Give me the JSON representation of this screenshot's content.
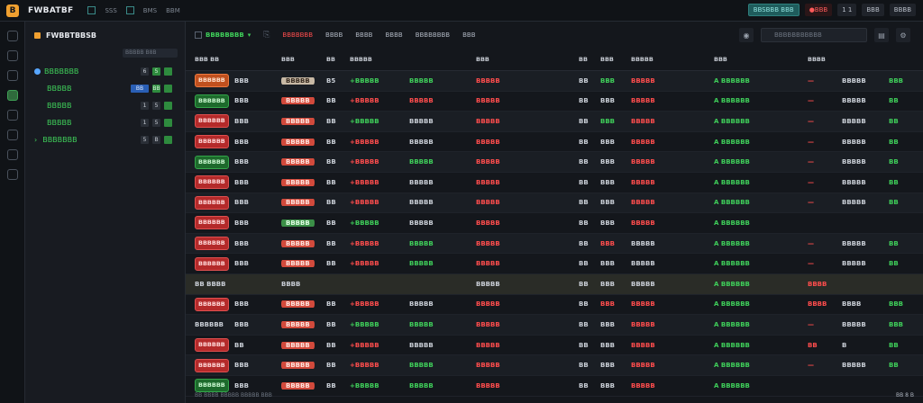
{
  "app": {
    "logo": "B",
    "title": "FWBATBF"
  },
  "top_menu": [
    "SSS",
    "BMS",
    "BBM"
  ],
  "top_right": {
    "account": "BBSBBB",
    "tag": "BBB",
    "alert": "BBB",
    "nums": "1 1",
    "stat": "BBB",
    "badge": "BBBB"
  },
  "icon_names": [
    "home-icon",
    "refresh-icon",
    "chart-icon",
    "layers-icon",
    "globe-icon",
    "bell-icon",
    "file-icon",
    "settings-icon"
  ],
  "left_panel": {
    "title": "FWBBTBBSB",
    "search_placeholder": "BBBBB B8B",
    "items": [
      {
        "label": "BBBBBBB",
        "num": "6",
        "ctrl": "5"
      },
      {
        "label": "BBBBB",
        "num": "BB",
        "ctrl": "BB"
      },
      {
        "label": "BBBBB",
        "num": "1",
        "ctrl": "5"
      },
      {
        "label": "BBBBB",
        "num": "1",
        "ctrl": "5"
      },
      {
        "label": "BBBBBBB",
        "num": "5",
        "ctrl": "B"
      }
    ]
  },
  "tabs": {
    "dropdown": "BBBBBBBB",
    "items": [
      "BBBBBBB",
      "BBBB",
      "BBBB",
      "BBBB",
      "BBBBBBBB",
      "BBB"
    ],
    "active_index": 0,
    "search_placeholder": "BBBBBBBBBBB"
  },
  "table": {
    "headers": [
      "BBB BB",
      "",
      "BBB",
      "BB",
      "BBBBB",
      "",
      "BBB",
      "BB",
      "BBB",
      "BBBBB",
      "BBB",
      "BBBB",
      "",
      ""
    ],
    "rows": [
      {
        "c0": "BBBBBB",
        "c0s": "orange",
        "c1": "BBB",
        "c2": "BBBBB",
        "c2s": "w",
        "c3": "B5",
        "c4": "+BBBBB",
        "c4d": "up",
        "c5": "BBBBB",
        "c5d": "up",
        "c6": "BBBBB",
        "c6d": "dn",
        "c7": "BB",
        "c8": "BBB",
        "c8d": "up",
        "c9": "BBBBB",
        "c9d": "dn",
        "c10": "A BBBBBB",
        "c10d": "up",
        "c11": "—",
        "c12": "BBBBB",
        "c13": "BBB"
      },
      {
        "c0": "BBBBBB",
        "c0s": "green",
        "c1": "BBB",
        "c2": "BBBBB",
        "c2s": "",
        "c3": "BB",
        "c4": "+BBBBB",
        "c4d": "dn",
        "c5": "BBBBB",
        "c5d": "dn",
        "c6": "BBBBB",
        "c6d": "dn",
        "c7": "BB",
        "c8": "BBB",
        "c8d": "mu",
        "c9": "BBBBB",
        "c9d": "dn",
        "c10": "A BBBBBB",
        "c10d": "up",
        "c11": "—",
        "c12": "BBBBB",
        "c13": "BB"
      },
      {
        "c0": "BBBBBB",
        "c0s": "red",
        "c1": "BBB",
        "c2": "BBBBB",
        "c2s": "",
        "c3": "BB",
        "c4": "+BBBBB",
        "c4d": "up",
        "c5": "BBBBB",
        "c5d": "mu",
        "c6": "BBBBB",
        "c6d": "dn",
        "c7": "BB",
        "c8": "BBB",
        "c8d": "up",
        "c9": "BBBBB",
        "c9d": "dn",
        "c10": "A BBBBBB",
        "c10d": "up",
        "c11": "—",
        "c12": "BBBBB",
        "c13": "BB"
      },
      {
        "c0": "BBBBBB",
        "c0s": "red",
        "c1": "BBB",
        "c2": "BBBBB",
        "c2s": "",
        "c3": "BB",
        "c4": "+BBBBB",
        "c4d": "dn",
        "c5": "BBBBB",
        "c5d": "mu",
        "c6": "BBBBB",
        "c6d": "dn",
        "c7": "BB",
        "c8": "BBB",
        "c8d": "mu",
        "c9": "BBBBB",
        "c9d": "dn",
        "c10": "A BBBBBB",
        "c10d": "up",
        "c11": "—",
        "c12": "BBBBB",
        "c13": "BB"
      },
      {
        "c0": "BBBBBB",
        "c0s": "green",
        "c1": "BBB",
        "c2": "BBBBB",
        "c2s": "",
        "c3": "BB",
        "c4": "+BBBBB",
        "c4d": "dn",
        "c5": "BBBBB",
        "c5d": "up",
        "c6": "BBBBB",
        "c6d": "dn",
        "c7": "BB",
        "c8": "BBB",
        "c8d": "mu",
        "c9": "BBBBB",
        "c9d": "dn",
        "c10": "A BBBBBB",
        "c10d": "up",
        "c11": "—",
        "c12": "BBBBB",
        "c13": "BB"
      },
      {
        "c0": "BBBBBB",
        "c0s": "red",
        "c1": "BBB",
        "c2": "BBBBB",
        "c2s": "",
        "c3": "BB",
        "c4": "+BBBBB",
        "c4d": "dn",
        "c5": "BBBBB",
        "c5d": "mu",
        "c6": "BBBBB",
        "c6d": "dn",
        "c7": "BB",
        "c8": "BBB",
        "c8d": "mu",
        "c9": "BBBBB",
        "c9d": "dn",
        "c10": "A BBBBBB",
        "c10d": "up",
        "c11": "—",
        "c12": "BBBBB",
        "c13": "BB"
      },
      {
        "c0": "BBBBBB",
        "c0s": "red",
        "c1": "BBB",
        "c2": "BBBBB",
        "c2s": "",
        "c3": "BB",
        "c4": "+BBBBB",
        "c4d": "dn",
        "c5": "BBBBB",
        "c5d": "mu",
        "c6": "BBBBB",
        "c6d": "dn",
        "c7": "BB",
        "c8": "BBB",
        "c8d": "mu",
        "c9": "BBBBB",
        "c9d": "dn",
        "c10": "A BBBBBB",
        "c10d": "up",
        "c11": "—",
        "c12": "BBBBB",
        "c13": "BB"
      },
      {
        "c0": "BBBBBB",
        "c0s": "red",
        "c1": "BBB",
        "c2": "BBBBB",
        "c2s": "g",
        "c3": "BB",
        "c4": "+BBBBB",
        "c4d": "up",
        "c5": "BBBBB",
        "c5d": "mu",
        "c6": "BBBBB",
        "c6d": "dn",
        "c7": "BB",
        "c8": "BBB",
        "c8d": "mu",
        "c9": "BBBBB",
        "c9d": "dn",
        "c10": "A BBBBBB",
        "c10d": "up",
        "c11": "",
        "c12": "",
        "c13": ""
      },
      {
        "c0": "BBBBBB",
        "c0s": "red",
        "c1": "BBB",
        "c2": "BBBBB",
        "c2s": "",
        "c3": "BB",
        "c4": "+BBBBB",
        "c4d": "dn",
        "c5": "BBBBB",
        "c5d": "up",
        "c6": "BBBBB",
        "c6d": "dn",
        "c7": "BB",
        "c8": "BBB",
        "c8d": "dn",
        "c9": "BBBBB",
        "c9d": "mu",
        "c10": "A BBBBBB",
        "c10d": "up",
        "c11": "—",
        "c12": "BBBBB",
        "c13": "BB"
      },
      {
        "c0": "BBBBBB",
        "c0s": "red",
        "c1": "BBB",
        "c2": "BBBBB",
        "c2s": "",
        "c3": "BB",
        "c4": "+BBBBB",
        "c4d": "dn",
        "c5": "BBBBB",
        "c5d": "up",
        "c6": "BBBBB",
        "c6d": "dn",
        "c7": "BB",
        "c8": "BBB",
        "c8d": "mu",
        "c9": "BBBBB",
        "c9d": "mu",
        "c10": "A BBBBBB",
        "c10d": "up",
        "c11": "—",
        "c12": "BBBBB",
        "c13": "BB"
      },
      {
        "c0": "BB BBBB",
        "c0s": "plain",
        "c1": "",
        "c2": "BBBB",
        "c2s": "plain",
        "c3": "",
        "c4": "",
        "c4d": "mu",
        "c5": "",
        "c5d": "mu",
        "c6": "BBBBB",
        "c6d": "mu",
        "c7": "BB",
        "c8": "BBB",
        "c8d": "mu",
        "c9": "BBBBB",
        "c9d": "mu",
        "c10": "A BBBBBB",
        "c10d": "up",
        "c11": "BBBB",
        "c12": "",
        "c13": ""
      },
      {
        "c0": "BBBBBB",
        "c0s": "red",
        "c1": "BBB",
        "c2": "BBBBB",
        "c2s": "",
        "c3": "BB",
        "c4": "+BBBBB",
        "c4d": "dn",
        "c5": "BBBBB",
        "c5d": "mu",
        "c6": "BBBBB",
        "c6d": "dn",
        "c7": "BB",
        "c8": "BBB",
        "c8d": "dn",
        "c9": "BBBBB",
        "c9d": "dn",
        "c10": "A BBBBBB",
        "c10d": "up",
        "c11": "BBBB",
        "c12": "BBBB",
        "c13": "BBB"
      },
      {
        "c0": "BBBBBB",
        "c0s": "plain",
        "c1": "BBB",
        "c2": "BBBBB",
        "c2s": "",
        "c3": "BB",
        "c4": "+BBBBB",
        "c4d": "up",
        "c5": "BBBBB",
        "c5d": "up",
        "c6": "BBBBB",
        "c6d": "dn",
        "c7": "BB",
        "c8": "BBB",
        "c8d": "mu",
        "c9": "BBBBB",
        "c9d": "dn",
        "c10": "A BBBBBB",
        "c10d": "up",
        "c11": "—",
        "c12": "BBBBB",
        "c13": "BBB"
      },
      {
        "c0": "BBBBBB",
        "c0s": "red",
        "c1": "BB",
        "c2": "BBBBB",
        "c2s": "",
        "c3": "BB",
        "c4": "+BBBBB",
        "c4d": "dn",
        "c5": "BBBBB",
        "c5d": "mu",
        "c6": "BBBBB",
        "c6d": "dn",
        "c7": "BB",
        "c8": "BBB",
        "c8d": "mu",
        "c9": "BBBBB",
        "c9d": "dn",
        "c10": "A BBBBBB",
        "c10d": "up",
        "c11": "BB",
        "c12": "B",
        "c13": "BB"
      },
      {
        "c0": "BBBBBB",
        "c0s": "red",
        "c1": "BBB",
        "c2": "BBBBB",
        "c2s": "",
        "c3": "BB",
        "c4": "+BBBBB",
        "c4d": "dn",
        "c5": "BBBBB",
        "c5d": "up",
        "c6": "BBBBB",
        "c6d": "dn",
        "c7": "BB",
        "c8": "BBB",
        "c8d": "mu",
        "c9": "BBBBB",
        "c9d": "dn",
        "c10": "A BBBBBB",
        "c10d": "up",
        "c11": "—",
        "c12": "BBBBB",
        "c13": "BB"
      },
      {
        "c0": "BBBBBB",
        "c0s": "green",
        "c1": "BBB",
        "c2": "BBBBB",
        "c2s": "",
        "c3": "BB",
        "c4": "+BBBBB",
        "c4d": "up",
        "c5": "BBBBB",
        "c5d": "up",
        "c6": "BBBBB",
        "c6d": "dn",
        "c7": "BB",
        "c8": "BBB",
        "c8d": "mu",
        "c9": "BBBBB",
        "c9d": "dn",
        "c10": "A BBBBBB",
        "c10d": "up",
        "c11": "",
        "c12": "",
        "c13": ""
      }
    ]
  },
  "status": {
    "left": "BB BBBB BBBBB BBBBB BBB",
    "right": "BB 8 B"
  }
}
